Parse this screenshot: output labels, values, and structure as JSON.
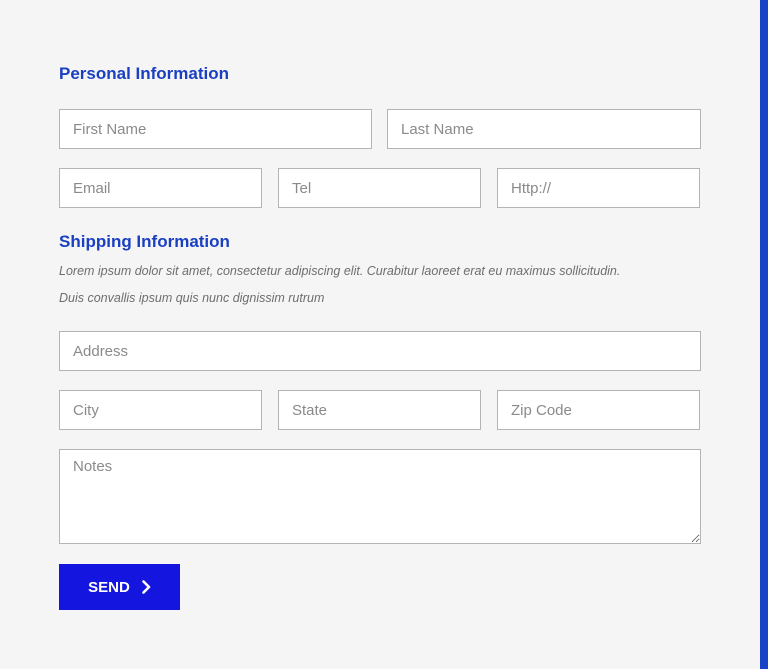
{
  "personal": {
    "heading": "Personal Information",
    "first_name_placeholder": "First Name",
    "last_name_placeholder": "Last Name",
    "email_placeholder": "Email",
    "tel_placeholder": "Tel",
    "website_placeholder": "Http://"
  },
  "shipping": {
    "heading": "Shipping Information",
    "description_line1": "Lorem ipsum dolor sit amet, consectetur adipiscing elit. Curabitur laoreet erat eu maximus sollicitudin.",
    "description_line2": "Duis convallis ipsum quis nunc dignissim rutrum",
    "address_placeholder": "Address",
    "city_placeholder": "City",
    "state_placeholder": "State",
    "zip_placeholder": "Zip Code",
    "notes_placeholder": "Notes"
  },
  "actions": {
    "send_label": "SEND",
    "send_icon": "chevron-right-icon"
  },
  "colors": {
    "heading": "#1a3fc1",
    "button": "#1515e0",
    "accent_bar": "#1a44c8"
  }
}
